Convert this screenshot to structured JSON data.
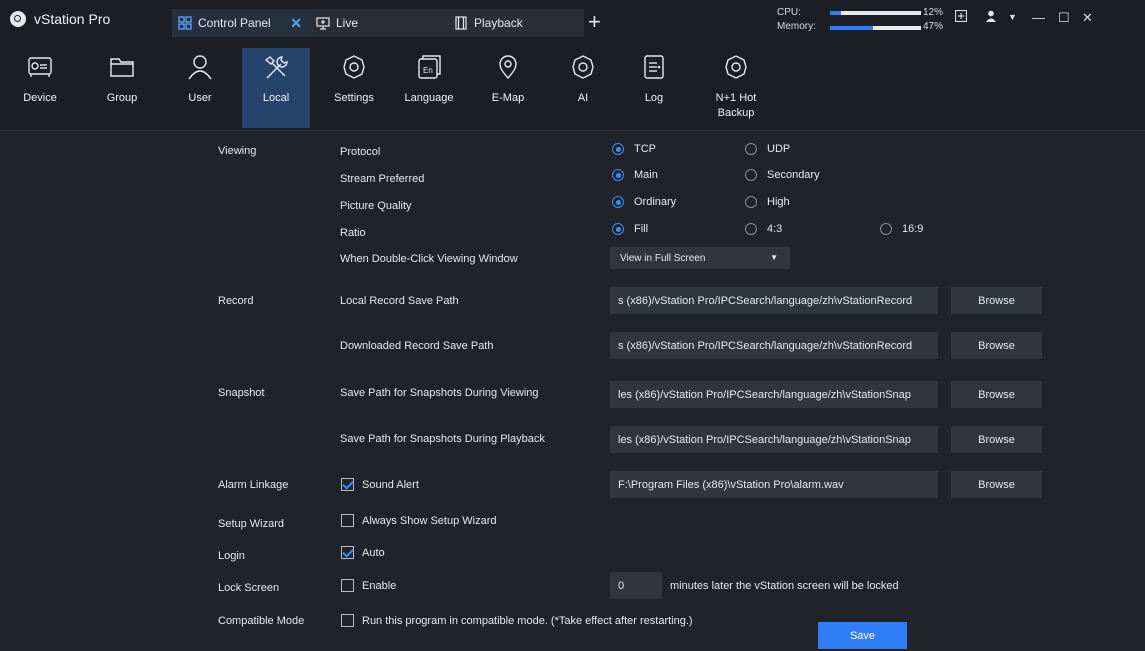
{
  "app": {
    "title": "vStation Pro"
  },
  "tabs": [
    {
      "label": "Control Panel",
      "active": true,
      "icon": "grid-icon"
    },
    {
      "label": "Live",
      "active": false,
      "icon": "monitor-icon"
    },
    {
      "label": "Playback",
      "active": false,
      "icon": "film-icon"
    }
  ],
  "system": {
    "cpu_label": "CPU:",
    "cpu_value": "12%",
    "cpu_fraction": 0.12,
    "memory_label": "Memory:",
    "memory_value": "47%",
    "memory_fraction": 0.47
  },
  "toolbar": [
    {
      "label": "Device",
      "icon": "device-icon"
    },
    {
      "label": "Group",
      "icon": "folder-icon"
    },
    {
      "label": "User",
      "icon": "user-icon"
    },
    {
      "label": "Local",
      "icon": "tools-icon",
      "active": true
    },
    {
      "label": "Settings",
      "icon": "settings-icon"
    },
    {
      "label": "Language",
      "icon": "language-icon"
    },
    {
      "label": "E-Map",
      "icon": "map-pin-icon"
    },
    {
      "label": "AI",
      "icon": "ai-icon"
    },
    {
      "label": "Log",
      "icon": "log-icon"
    },
    {
      "label": "N+1 Hot Backup",
      "icon": "backup-icon"
    }
  ],
  "viewing": {
    "section": "Viewing",
    "protocol": {
      "label": "Protocol",
      "options": [
        "TCP",
        "UDP"
      ],
      "selected": "TCP"
    },
    "stream": {
      "label": "Stream Preferred",
      "options": [
        "Main",
        "Secondary"
      ],
      "selected": "Main"
    },
    "quality": {
      "label": "Picture Quality",
      "options": [
        "Ordinary",
        "High"
      ],
      "selected": "Ordinary"
    },
    "ratio": {
      "label": "Ratio",
      "options": [
        "Fill",
        "4:3",
        "16:9"
      ],
      "selected": "Fill"
    },
    "double_click": {
      "label": "When Double-Click Viewing Window",
      "value": "View in Full Screen"
    }
  },
  "record": {
    "section": "Record",
    "local_label": "Local Record Save Path",
    "local_path": "s (x86)/vStation Pro/IPCSearch/language/zh\\vStationRecord",
    "downloaded_label": "Downloaded Record Save Path",
    "downloaded_path": "s (x86)/vStation Pro/IPCSearch/language/zh\\vStationRecord"
  },
  "snapshot": {
    "section": "Snapshot",
    "viewing_label": "Save Path for Snapshots During Viewing",
    "viewing_path": "les (x86)/vStation Pro/IPCSearch/language/zh\\vStationSnap",
    "playback_label": "Save Path for Snapshots During Playback",
    "playback_path": "les (x86)/vStation Pro/IPCSearch/language/zh\\vStationSnap"
  },
  "alarm": {
    "section": "Alarm Linkage",
    "sound_label": "Sound Alert",
    "sound_checked": true,
    "path": "F:\\Program Files (x86)\\vStation Pro\\alarm.wav"
  },
  "browse_label": "Browse",
  "wizard": {
    "section": "Setup Wizard",
    "label": "Always Show Setup Wizard",
    "checked": false
  },
  "login": {
    "section": "Login",
    "label": "Auto",
    "checked": true
  },
  "lock": {
    "section": "Lock Screen",
    "label": "Enable",
    "checked": false,
    "minutes": "0",
    "minutes_text": "minutes later the vStation screen will be locked"
  },
  "compatible": {
    "section": "Compatible Mode",
    "label": "Run this program in compatible mode. (*Take effect after restarting.)",
    "checked": false
  },
  "save_label": "Save"
}
